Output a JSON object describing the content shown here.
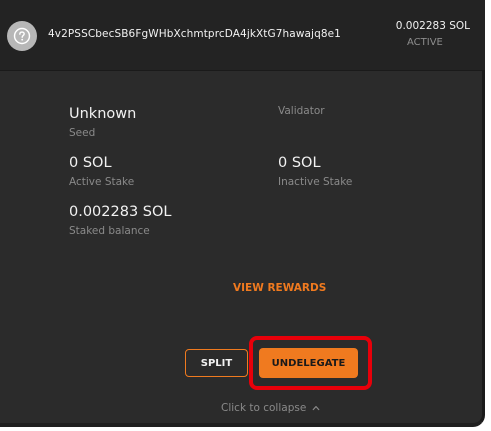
{
  "header": {
    "address": "4v2PSSCbecSB6FgWHbXchmtprcDA4jkXtG7hawajq8e1",
    "balance": "0.002283 SOL",
    "status": "ACTIVE",
    "icon": "question-circle-icon"
  },
  "details": {
    "seed": {
      "value": "Unknown",
      "label": "Seed"
    },
    "validator": {
      "value": "",
      "label": "Validator"
    },
    "active_stake": {
      "value": "0 SOL",
      "label": "Active Stake"
    },
    "inactive_stake": {
      "value": "0 SOL",
      "label": "Inactive Stake"
    },
    "staked_balance": {
      "value": "0.002283 SOL",
      "label": "Staked balance"
    }
  },
  "actions": {
    "view_rewards": "VIEW REWARDS",
    "split": "SPLIT",
    "undelegate": "UNDELEGATE"
  },
  "footer": {
    "collapse": "Click to collapse",
    "collapse_icon": "chevron-up-icon"
  },
  "colors": {
    "accent": "#f07a1f",
    "highlight": "#e8000a",
    "background": "#2b2b2b"
  }
}
